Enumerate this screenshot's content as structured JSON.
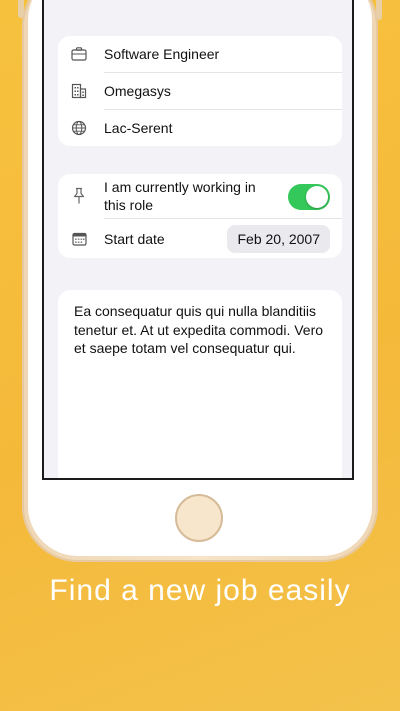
{
  "job": {
    "title": "Software Engineer",
    "company": "Omegasys",
    "location": "Lac-Serent"
  },
  "employment": {
    "current_role_label": "I am currently working in this role",
    "current_role_on": true,
    "start_date_label": "Start date",
    "start_date_value": "Feb 20, 2007"
  },
  "description": "Ea consequatur quis qui nulla blanditiis tenetur et. At ut expedita commodi. Vero et saepe totam vel consequatur qui.",
  "tagline": "Find a new job easily",
  "colors": {
    "accent_green": "#34c759",
    "background": "#f6c23e"
  }
}
